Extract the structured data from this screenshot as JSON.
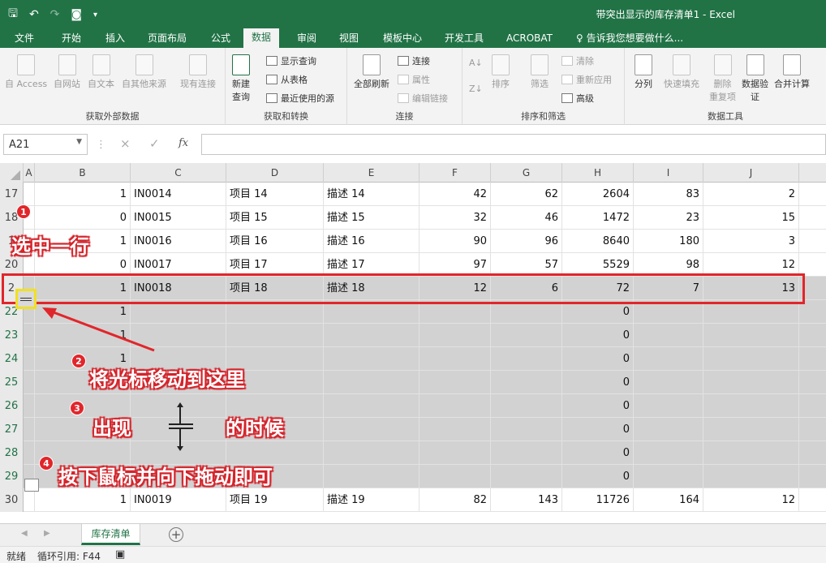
{
  "window": {
    "title": "带突出显示的库存清单1 - Excel"
  },
  "tabs": [
    "文件",
    "开始",
    "插入",
    "页面布局",
    "公式",
    "数据",
    "审阅",
    "视图",
    "模板中心",
    "开发工具",
    "ACROBAT"
  ],
  "active_tab": "数据",
  "tell_me": "告诉我您想要做什么...",
  "ribbon": {
    "external": {
      "title": "获取外部数据",
      "access": "自 Access",
      "web": "自网站",
      "text": "自文本",
      "other": "自其他来源",
      "existing": "现有连接"
    },
    "transform": {
      "title": "获取和转换",
      "new_query": "新建",
      "new_query2": "查询",
      "show_queries": "显示查询",
      "from_table": "从表格",
      "recent": "最近使用的源"
    },
    "connections": {
      "title": "连接",
      "refresh_all": "全部刷新",
      "connections": "连接",
      "properties": "属性",
      "edit_links": "编辑链接"
    },
    "sort_filter": {
      "title": "排序和筛选",
      "sort": "排序",
      "filter": "筛选",
      "clear": "清除",
      "reapply": "重新应用",
      "advanced": "高级"
    },
    "data_tools": {
      "title": "数据工具",
      "split": "分列",
      "flash_fill": "快速填充",
      "remove_dup": "删除",
      "remove_dup2": "重复项",
      "validation": "数据验",
      "validation2": "证",
      "consolidate": "合并计算"
    }
  },
  "formula_bar": {
    "name_box": "A21",
    "cancel": "×",
    "enter": "✓",
    "fx": "fx",
    "value": ""
  },
  "columns": [
    "A",
    "B",
    "C",
    "D",
    "E",
    "F",
    "G",
    "H",
    "I",
    "J"
  ],
  "rows": [
    {
      "num": "17",
      "b": "1",
      "c": "IN0014",
      "d": "项目 14",
      "e": "描述 14",
      "f": "42",
      "g": "62",
      "h": "2604",
      "i": "83",
      "j": "2"
    },
    {
      "num": "18",
      "b": "0",
      "c": "IN0015",
      "d": "项目 15",
      "e": "描述 15",
      "f": "32",
      "g": "46",
      "h": "1472",
      "i": "23",
      "j": "15"
    },
    {
      "num": "1",
      "b": "1",
      "c": "IN0016",
      "d": "项目 16",
      "e": "描述 16",
      "f": "90",
      "g": "96",
      "h": "8640",
      "i": "180",
      "j": "3"
    },
    {
      "num": "20",
      "b": "0",
      "c": "IN0017",
      "d": "项目 17",
      "e": "描述 17",
      "f": "97",
      "g": "57",
      "h": "5529",
      "i": "98",
      "j": "12"
    },
    {
      "num": "2",
      "b": "1",
      "c": "IN0018",
      "d": "项目 18",
      "e": "描述 18",
      "f": "12",
      "g": "6",
      "h": "72",
      "i": "7",
      "j": "13"
    },
    {
      "num": "22",
      "b": "1",
      "c": "",
      "d": "",
      "e": "",
      "f": "",
      "g": "",
      "h": "0",
      "i": "",
      "j": ""
    },
    {
      "num": "23",
      "b": "1",
      "c": "",
      "d": "",
      "e": "",
      "f": "",
      "g": "",
      "h": "0",
      "i": "",
      "j": ""
    },
    {
      "num": "24",
      "b": "1",
      "c": "",
      "d": "",
      "e": "",
      "f": "",
      "g": "",
      "h": "0",
      "i": "",
      "j": ""
    },
    {
      "num": "25",
      "b": "",
      "c": "",
      "d": "",
      "e": "",
      "f": "",
      "g": "",
      "h": "0",
      "i": "",
      "j": ""
    },
    {
      "num": "26",
      "b": "",
      "c": "",
      "d": "",
      "e": "",
      "f": "",
      "g": "",
      "h": "0",
      "i": "",
      "j": ""
    },
    {
      "num": "27",
      "b": "",
      "c": "",
      "d": "",
      "e": "",
      "f": "",
      "g": "",
      "h": "0",
      "i": "",
      "j": ""
    },
    {
      "num": "28",
      "b": "",
      "c": "",
      "d": "",
      "e": "",
      "f": "",
      "g": "",
      "h": "0",
      "i": "",
      "j": ""
    },
    {
      "num": "29",
      "b": "",
      "c": "",
      "d": "",
      "e": "",
      "f": "",
      "g": "",
      "h": "0",
      "i": "",
      "j": ""
    },
    {
      "num": "30",
      "b": "1",
      "c": "IN0019",
      "d": "项目 19",
      "e": "描述 19",
      "f": "82",
      "g": "143",
      "h": "11726",
      "i": "164",
      "j": "12"
    }
  ],
  "annotations": {
    "step1": "选中一行",
    "step2": "将光标移动到这里",
    "step3a": "出现",
    "step3b": "的时候",
    "step4": "按下鼠标并向下拖动即可",
    "b1": "1",
    "b2": "2",
    "b3": "3",
    "b4": "4"
  },
  "sheet_tab": "库存清单",
  "status": {
    "ready": "就绪",
    "circular": "循环引用: F44"
  },
  "colors": {
    "excel_green": "#217346",
    "highlight_red": "#e1262b",
    "handle_yellow": "#f1e021"
  }
}
